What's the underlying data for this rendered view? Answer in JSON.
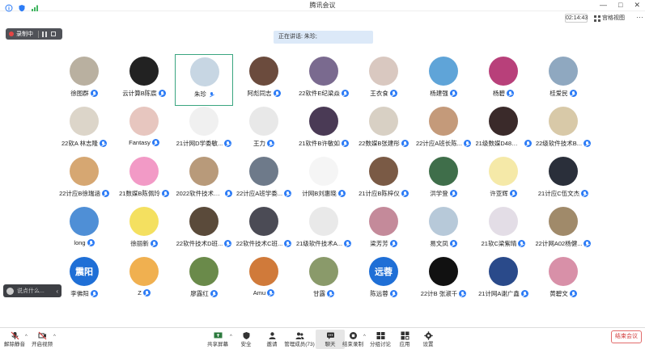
{
  "window": {
    "title": "腾讯会议"
  },
  "topbar": {
    "timer": "02:14:43",
    "view_label": "宫格视图",
    "more": "···"
  },
  "recording": {
    "label": "录制中"
  },
  "speaking": {
    "text": "正在讲话: 朱珍;"
  },
  "participants": [
    {
      "name": "徐图群",
      "color": "#b9b0a0"
    },
    {
      "name": "云计算B陈宸",
      "color": "#222222"
    },
    {
      "name": "朱珍",
      "color": "#c7d6e3",
      "active": true
    },
    {
      "name": "阿彪同志",
      "color": "#6b4b3d"
    },
    {
      "name": "22软件E纪梁焱",
      "color": "#7a6a8f"
    },
    {
      "name": "王衣食",
      "color": "#d9c8c0"
    },
    {
      "name": "杨建强",
      "color": "#5fa4d8"
    },
    {
      "name": "杨碧",
      "color": "#b8407a"
    },
    {
      "name": "桂爱民",
      "color": "#8fa8c0"
    },
    {
      "name": "22软A 林志隆",
      "color": "#dcd5c9"
    },
    {
      "name": "Fantasy",
      "color": "#e7c6bf"
    },
    {
      "name": "21计网D学委敏...",
      "color": "#f0f0f0"
    },
    {
      "name": "王力",
      "color": "#e8e8e8"
    },
    {
      "name": "21软件B许敏如",
      "color": "#4a3a55"
    },
    {
      "name": "22数媒B张建彤",
      "color": "#d8d0c4"
    },
    {
      "name": "22计应A班长陈...",
      "color": "#c49a7a"
    },
    {
      "name": "21级数媒D48朱柏怡",
      "color": "#3a2a2a"
    },
    {
      "name": "22级软件技术B...",
      "color": "#d8c9a8"
    },
    {
      "name": "22计应B徐瑞涵",
      "color": "#d6a772"
    },
    {
      "name": "21数媒B陈佩玲",
      "color": "#f29ac6"
    },
    {
      "name": "2022软件技术D...",
      "color": "#b89a7a"
    },
    {
      "name": "22计应A班学委...",
      "color": "#6e7a8a"
    },
    {
      "name": "计网B刘惠晓",
      "color": "#f5f5f5"
    },
    {
      "name": "21计应B陈梓仪",
      "color": "#7a5a45"
    },
    {
      "name": "洪学登",
      "color": "#3f6e4a"
    },
    {
      "name": "许亚辉",
      "color": "#f5e9a8"
    },
    {
      "name": "21计应C伍文杰",
      "color": "#2a2f3a"
    },
    {
      "name": "long",
      "color": "#4f8fd6"
    },
    {
      "name": "徐丽新",
      "color": "#f4e060"
    },
    {
      "name": "22软件技术D班...",
      "color": "#5a4a3a"
    },
    {
      "name": "22软件技术C班...",
      "color": "#4b4b55"
    },
    {
      "name": "21级软件技术A...",
      "color": "#e9e9e9"
    },
    {
      "name": "梁芳芳",
      "color": "#c48a9a"
    },
    {
      "name": "易文凤",
      "color": "#b7c9d9"
    },
    {
      "name": "21软C梁紫晴",
      "color": "#e3dde6"
    },
    {
      "name": "22计网A02杨健...",
      "color": "#a08a6a"
    },
    {
      "name": "李佛阳",
      "color": "#1f6fd6",
      "text": "震阳"
    },
    {
      "name": "Z",
      "color": "#f0b050"
    },
    {
      "name": "廖露红",
      "color": "#6a8a4a"
    },
    {
      "name": "Amu",
      "color": "#d07a3a"
    },
    {
      "name": "甘露",
      "color": "#8a9a6a"
    },
    {
      "name": "陈远蓉",
      "color": "#1f6fd6",
      "text": "远蓉"
    },
    {
      "name": "22计B 张淑千",
      "color": "#111111"
    },
    {
      "name": "21计网A谢广鑫",
      "color": "#2a4a8a"
    },
    {
      "name": "黄碧文",
      "color": "#d890a8"
    }
  ],
  "chat": {
    "placeholder": "说点什么..."
  },
  "toolbar": {
    "mute": "解除静音",
    "video": "开启视频",
    "share": "共享屏幕",
    "security": "安全",
    "invite": "邀请",
    "manage": "管理成员(73)",
    "chat": "聊天",
    "record": "结束录制",
    "breakout": "分组讨论",
    "apps": "应用",
    "settings": "设置",
    "end": "结束会议"
  },
  "colors": {
    "accent": "#2d7cf6",
    "danger": "#d23b3b",
    "active_border": "#3aa580"
  }
}
